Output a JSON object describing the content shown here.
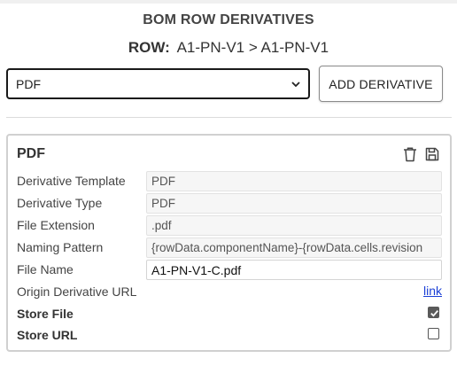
{
  "header": {
    "title": "BOM ROW DERIVATIVES",
    "row_label": "ROW:",
    "row_value": "A1-PN-V1 > A1-PN-V1"
  },
  "toolbar": {
    "select_value": "PDF",
    "add_label": "ADD DERIVATIVE"
  },
  "card": {
    "title": "PDF",
    "icons": [
      "trash-icon",
      "save-icon"
    ],
    "fields": [
      {
        "label": "Derivative Template",
        "value": "PDF"
      },
      {
        "label": "Derivative Type",
        "value": "PDF"
      },
      {
        "label": "File Extension",
        "value": ".pdf"
      },
      {
        "label": "Naming Pattern",
        "value": "{rowData.componentName}-{rowData.cells.revision"
      },
      {
        "label": "File Name",
        "value": "A1-PN-V1-C.pdf"
      }
    ],
    "origin": {
      "label": "Origin Derivative URL",
      "link_text": "link"
    },
    "store_file": {
      "label": "Store File",
      "checked": true
    },
    "store_url": {
      "label": "Store URL",
      "checked": false
    }
  },
  "colors": {
    "link": "#1a3fd6",
    "select_border": "#1a1a1a",
    "card_border": "#d0d0d0"
  }
}
